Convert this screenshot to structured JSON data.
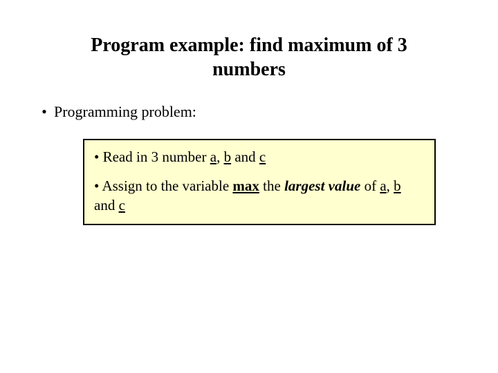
{
  "title": "Program example: find maximum of 3 numbers",
  "bullet1": {
    "marker": "•",
    "text": "Programming problem:"
  },
  "box": {
    "line1": {
      "marker": "•",
      "t1": " Read in 3 number ",
      "a": "a",
      "comma1": ", ",
      "b": "b",
      "mid": " and ",
      "c": "c"
    },
    "line2": {
      "marker": "•",
      "t1": " Assign to the variable ",
      "max": "max",
      "t2": " the ",
      "largest_value": "largest value",
      "t3": " of ",
      "a": "a",
      "comma1": ", ",
      "b": "b",
      "mid": " and ",
      "c": "c"
    }
  }
}
